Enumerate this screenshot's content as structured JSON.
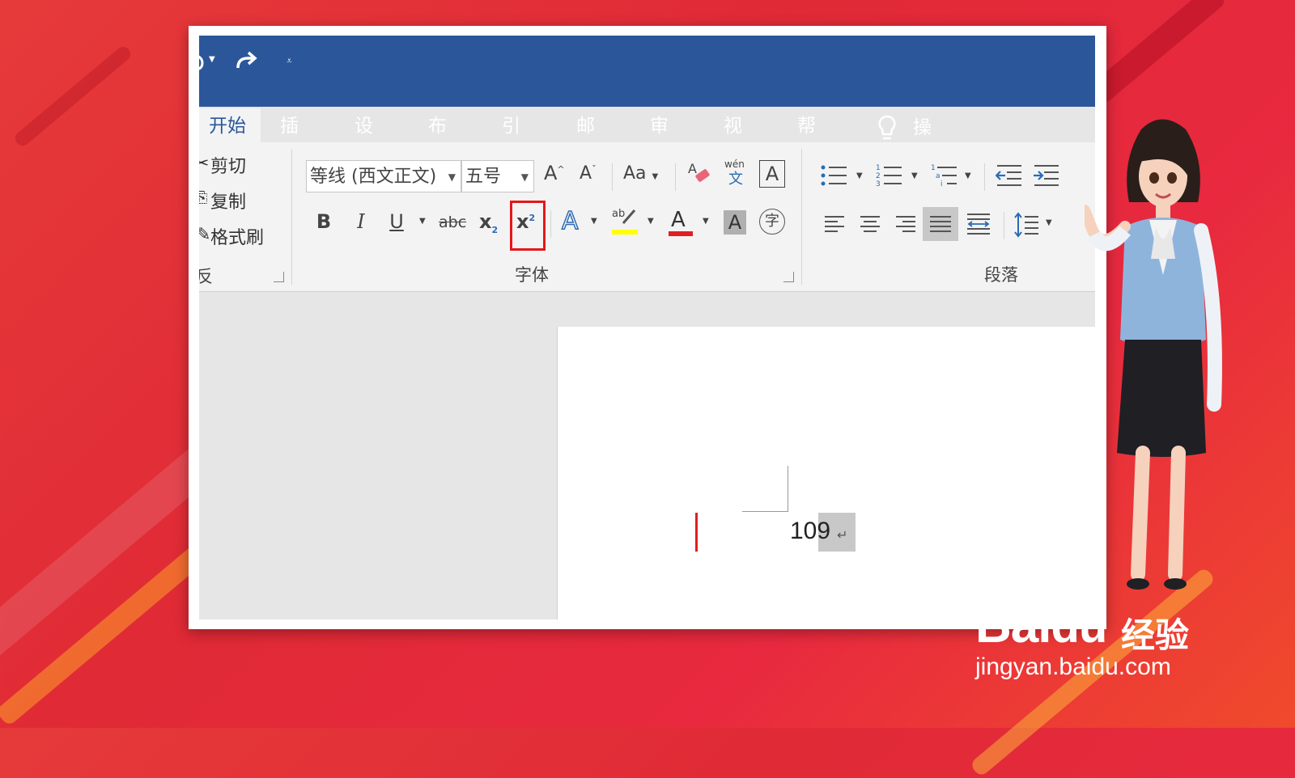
{
  "quick_access": {
    "undo_icon": "undo-icon",
    "redo_icon": "redo-icon",
    "customize_icon": "qat-dropdown-icon"
  },
  "tabs": [
    "开始",
    "插入",
    "设计",
    "布局",
    "引用",
    "邮件",
    "审阅",
    "视图",
    "帮助"
  ],
  "tell_me": "操作说明搜索",
  "clipboard": {
    "cut": "剪切",
    "copy": "复制",
    "format_painter": "格式刷",
    "group_label_partial": "反"
  },
  "font": {
    "font_name": "等线 (西文正文)",
    "font_size": "五号",
    "grow": "A",
    "shrink": "A",
    "change_case": "Aa",
    "bold": "B",
    "italic": "I",
    "underline": "U",
    "strike": "abc",
    "subscript": "x",
    "superscript": "x",
    "group_label": "字体"
  },
  "paragraph": {
    "group_label": "段落"
  },
  "document": {
    "text": "109"
  },
  "watermark": {
    "brand": "Bai",
    "brand2": "du",
    "brand_cn": "经验",
    "url": "jingyan.baidu.com"
  },
  "colors": {
    "titlebar": "#2b579a",
    "highlight": "#e5161a",
    "font_color": "#e02020",
    "highlight_color": "#ffff00"
  }
}
